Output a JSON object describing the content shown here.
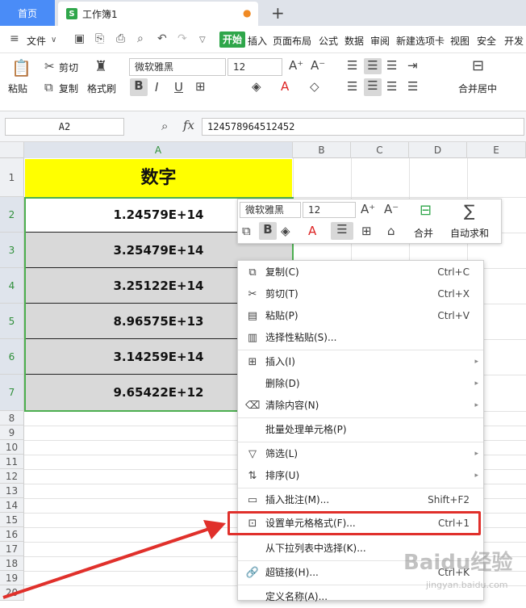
{
  "tabs": {
    "home": "首页",
    "workbook": "工作簿1",
    "new_tab": "+"
  },
  "menu": [
    "文件",
    "开始",
    "插入",
    "页面布局",
    "公式",
    "数据",
    "审阅",
    "新建选项卡",
    "视图",
    "安全",
    "开发"
  ],
  "ribbon": {
    "paste": "粘贴",
    "cut": "剪切",
    "copy": "复制",
    "format_painter": "格式刷",
    "font": "微软雅黑",
    "size": "12",
    "bold": "B",
    "italic": "I",
    "underline": "U",
    "merge_center": "合并居中"
  },
  "formula_bar": {
    "name_box": "A2",
    "fx": "fx",
    "value": "124578964512452"
  },
  "columns": [
    "A",
    "B",
    "C",
    "D",
    "E"
  ],
  "rows": [
    "1",
    "2",
    "3",
    "4",
    "5",
    "6",
    "7",
    "8",
    "9",
    "10",
    "11",
    "12",
    "13",
    "14",
    "15",
    "16",
    "17",
    "18",
    "19",
    "20"
  ],
  "cells": {
    "header": "数字",
    "values": [
      "1.24579E+14",
      "3.25479E+14",
      "3.25122E+14",
      "8.96575E+13",
      "3.14259E+14",
      "9.65422E+12"
    ]
  },
  "mini_toolbar": {
    "font": "微软雅黑",
    "size": "12",
    "bold": "B",
    "merge": "合并",
    "autosum": "自动求和"
  },
  "context_menu": [
    {
      "label": "复制(C)",
      "shortcut": "Ctrl+C",
      "icon": "copy-icon"
    },
    {
      "label": "剪切(T)",
      "shortcut": "Ctrl+X",
      "icon": "scissors-icon"
    },
    {
      "label": "粘贴(P)",
      "shortcut": "Ctrl+V",
      "icon": "paste-icon"
    },
    {
      "label": "选择性粘贴(S)...",
      "shortcut": "",
      "icon": "paste-special-icon"
    },
    {
      "label": "插入(I)",
      "shortcut": "",
      "icon": "insert-icon",
      "submenu": true
    },
    {
      "label": "删除(D)",
      "shortcut": "",
      "icon": "",
      "submenu": true
    },
    {
      "label": "清除内容(N)",
      "shortcut": "",
      "icon": "eraser-icon",
      "submenu": true
    },
    {
      "label": "批量处理单元格(P)",
      "shortcut": "",
      "icon": ""
    },
    {
      "label": "筛选(L)",
      "shortcut": "",
      "icon": "filter-icon",
      "submenu": true
    },
    {
      "label": "排序(U)",
      "shortcut": "",
      "icon": "sort-icon",
      "submenu": true
    },
    {
      "label": "插入批注(M)...",
      "shortcut": "Shift+F2",
      "icon": "comment-icon"
    },
    {
      "label": "设置单元格格式(F)...",
      "shortcut": "Ctrl+1",
      "icon": "format-cells-icon"
    },
    {
      "label": "从下拉列表中选择(K)...",
      "shortcut": "",
      "icon": ""
    },
    {
      "label": "超链接(H)...",
      "shortcut": "Ctrl+K",
      "icon": "link-icon"
    },
    {
      "label": "定义名称(A)...",
      "shortcut": "",
      "icon": ""
    }
  ],
  "watermark": {
    "line1": "Baidu经验",
    "line2": "jingyan.baidu.com"
  },
  "colors": {
    "header_fill": "#ffff00",
    "value_fill": "#d9d9d9",
    "selection": "#4caf50",
    "highlight": "#e0302b",
    "accent": "#2fa64a"
  }
}
